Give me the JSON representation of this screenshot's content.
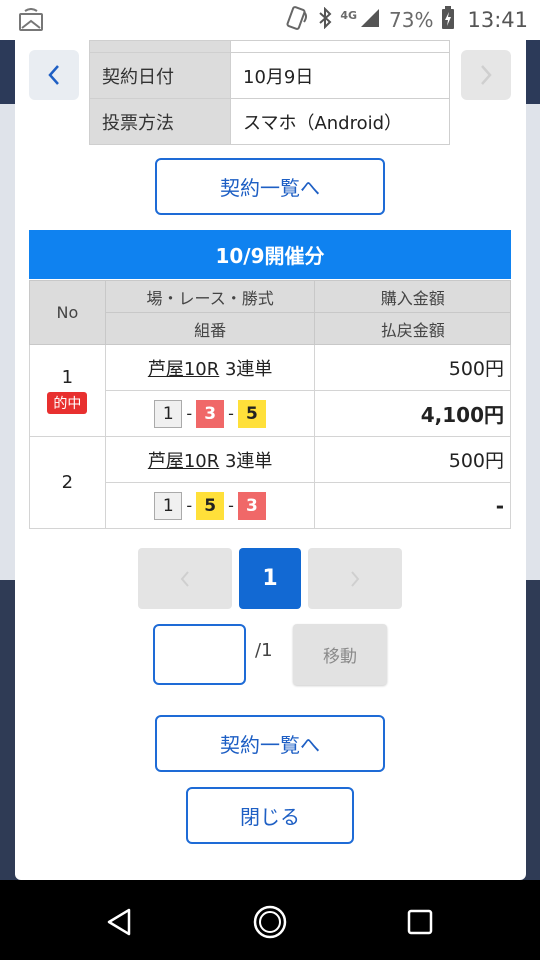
{
  "status_bar": {
    "network": "4G",
    "battery": "73%",
    "time": "13:41"
  },
  "contract_info": {
    "rows": [
      {
        "label": "契約日付",
        "value": "10月9日"
      },
      {
        "label": "投票方法",
        "value": "スマホ（Android）"
      }
    ]
  },
  "buttons": {
    "contract_list_top": "契約一覧へ",
    "contract_list_bottom": "契約一覧へ",
    "close": "閉じる",
    "move": "移動"
  },
  "results": {
    "header": "10/9開催分",
    "columns": {
      "no": "No",
      "race_header": "場・レース・勝式",
      "combo_header": "組番",
      "purchase_header": "購入金額",
      "refund_header": "払戻金額"
    },
    "rows": [
      {
        "no": "1",
        "badge": "的中",
        "race": "芦屋10R",
        "bet_type": "3連単",
        "combo": [
          "1",
          "3",
          "5"
        ],
        "purchase": "500円",
        "refund": "4,100円"
      },
      {
        "no": "2",
        "badge": "",
        "race": "芦屋10R",
        "bet_type": "3連単",
        "combo": [
          "1",
          "5",
          "3"
        ],
        "purchase": "500円",
        "refund": "-"
      }
    ]
  },
  "pagination": {
    "current": "1",
    "total": "/1",
    "input_value": ""
  },
  "colors": {
    "header_blue": "#0f82f0",
    "button_blue": "#1269d3",
    "hit_red": "#e8302f",
    "boat_3_red": "#f06868",
    "boat_5_yellow": "#ffe03a"
  },
  "icons": {
    "prev": "chevron-left-icon",
    "next": "chevron-right-icon",
    "nav_back": "triangle-back-icon",
    "nav_home": "circle-home-icon",
    "nav_recents": "square-recents-icon"
  }
}
